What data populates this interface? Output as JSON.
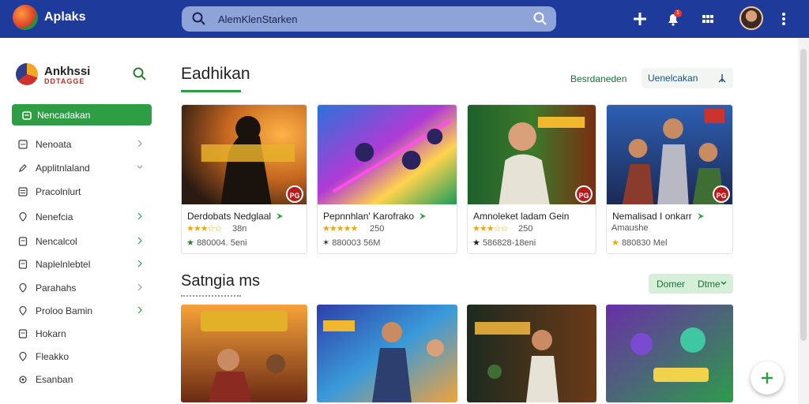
{
  "topbar": {
    "app_title": "Aplaks",
    "search_placeholder": "AlemKlenStarken",
    "notification_count": "1",
    "icons": [
      "add-icon",
      "notification-bell-icon",
      "apps-grid-icon",
      "more-vertical-icon"
    ]
  },
  "sidebar": {
    "brand_name": "Ankhssi",
    "brand_sub": "DDTAGGE",
    "active_item": "Nencadakan",
    "items": [
      {
        "label": "Nenoata",
        "icon": "square-icon",
        "chevron": true
      },
      {
        "label": "Applitnlaland",
        "icon": "edit-icon",
        "chevron": true
      },
      {
        "label": "Pracolnlurt",
        "icon": "list-icon",
        "chevron": false
      },
      {
        "label": "Nenefcia",
        "icon": "location-icon",
        "chevron": true
      },
      {
        "label": "Nencalcol",
        "icon": "document-icon",
        "chevron": true
      },
      {
        "label": "Naplelnlebtel",
        "icon": "document-icon",
        "chevron": true
      },
      {
        "label": "Parahahs",
        "icon": "location-icon",
        "chevron": true
      },
      {
        "label": "Proloo Bamin",
        "icon": "location-icon",
        "chevron": true
      },
      {
        "label": "Hokarn",
        "icon": "document-icon",
        "chevron": false
      },
      {
        "label": "Fleakko",
        "icon": "location-icon",
        "chevron": false
      },
      {
        "label": "Esanban",
        "icon": "settings-icon",
        "chevron": false
      }
    ]
  },
  "main": {
    "title": "Eadhikan",
    "link_button": "Besrdaneden",
    "outline_button": "Uenelcakan",
    "cards": [
      {
        "name": "Derdobats Nedglaal",
        "rating_count": "38n",
        "meta": "880004. 5eni",
        "age": "PG",
        "meta_icon": "star-dark-icon"
      },
      {
        "name": "Pepnnhlan' Karofrako",
        "rating_count": "250",
        "meta": "880003 56M",
        "age": "",
        "meta_icon": "star-outline-icon"
      },
      {
        "name": "Amnoleket ladam Gein",
        "rating_count": "250",
        "meta": "586828-18eni",
        "age": "PG",
        "meta_icon": "star-dark-icon"
      },
      {
        "name": "Nemalisad I onkarr",
        "rating_count": "",
        "meta": "880830 Mel",
        "age": "PG",
        "meta_icon": "star-gold-icon",
        "sub": "Amaushe"
      }
    ],
    "section2_title": "Satngia ms",
    "section2_button_a": "Domer",
    "section2_button_b": "Dtme",
    "accent_color": "#2e9e44",
    "header_color": "#1e3a9a"
  }
}
